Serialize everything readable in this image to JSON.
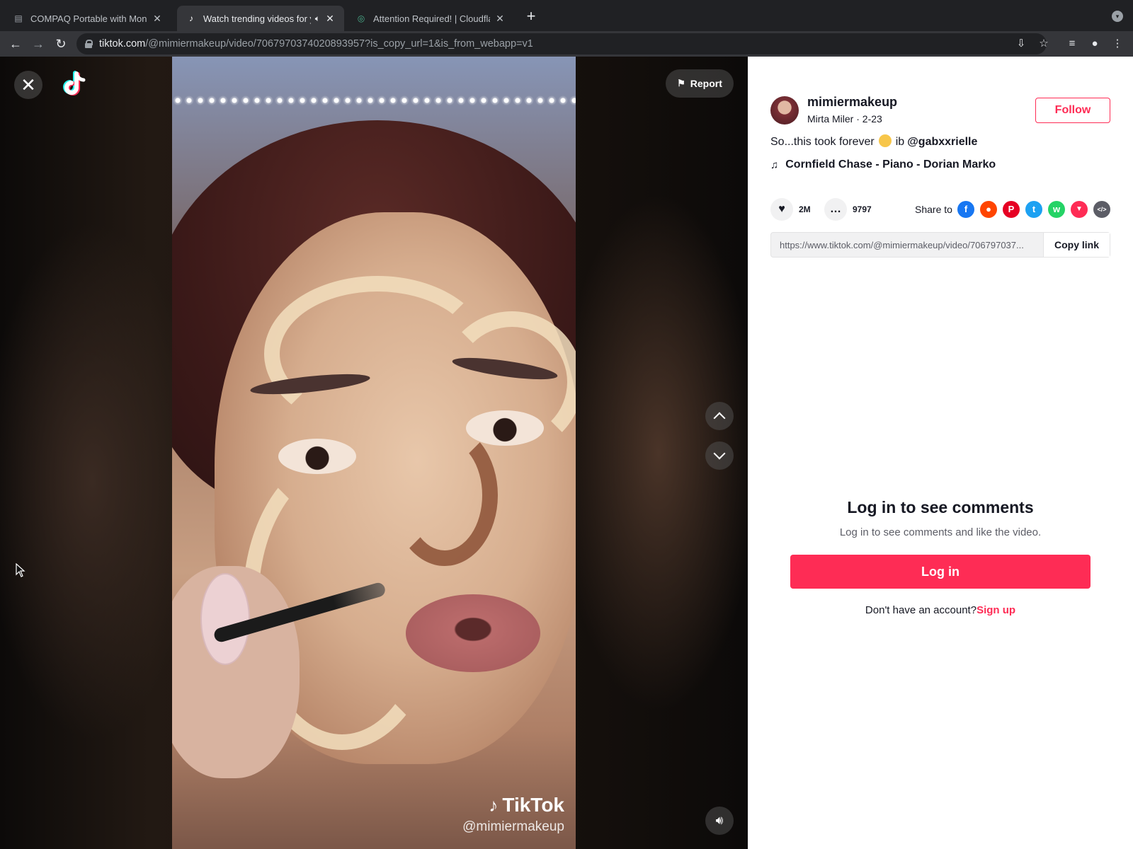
{
  "browser": {
    "tabs": [
      {
        "title": "COMPAQ Portable with Monoc",
        "favicon": "compaq-favicon"
      },
      {
        "title": "Watch trending videos for y",
        "favicon": "tiktok-favicon",
        "audio": "speaker-icon"
      },
      {
        "title": "Attention Required! | Cloudflar",
        "favicon": "cloudflare-favicon"
      }
    ],
    "new_tab": "+",
    "url_host": "tiktok.com",
    "url_path": "/@mimiermakeup/video/7067970374020893957?is_copy_url=1&is_from_webapp=v1"
  },
  "video": {
    "watermark_brand": "TikTok",
    "watermark_user": "@mimiermakeup",
    "report_label": "Report",
    "close_glyph": "✕"
  },
  "author": {
    "username": "mimiermakeup",
    "display_name": "Mirta Miler",
    "date": "2-23",
    "follow_label": "Follow"
  },
  "post": {
    "caption_text": "So...this took forever",
    "caption_suffix": "ib",
    "mention": "@gabxxrielle",
    "music": "Cornfield Chase - Piano - Dorian Marko"
  },
  "stats": {
    "likes": "2M",
    "comments": "9797",
    "share_label": "Share to"
  },
  "share_targets": [
    {
      "name": "facebook-icon",
      "color": "#1877f2",
      "glyph": "f"
    },
    {
      "name": "reddit-icon",
      "color": "#ff4500",
      "glyph": "●"
    },
    {
      "name": "pinterest-icon",
      "color": "#e60023",
      "glyph": "P"
    },
    {
      "name": "twitter-icon",
      "color": "#1da1f2",
      "glyph": "t"
    },
    {
      "name": "whatsapp-icon",
      "color": "#25d366",
      "glyph": "w"
    },
    {
      "name": "send-icon",
      "color": "#fe2c55",
      "glyph": "▼"
    },
    {
      "name": "embed-icon",
      "color": "#5c5d66",
      "glyph": "</>"
    }
  ],
  "link": {
    "url": "https://www.tiktok.com/@mimiermakeup/video/706797037...",
    "copy_label": "Copy link"
  },
  "login": {
    "title": "Log in to see comments",
    "subtitle": "Log in to see comments and like the video.",
    "button": "Log in",
    "no_account": "Don't have an account?",
    "signup": "Sign up"
  },
  "colors": {
    "brand": "#fe2c55",
    "chrome_dark": "#202124",
    "chrome_toolbar": "#35363a"
  }
}
